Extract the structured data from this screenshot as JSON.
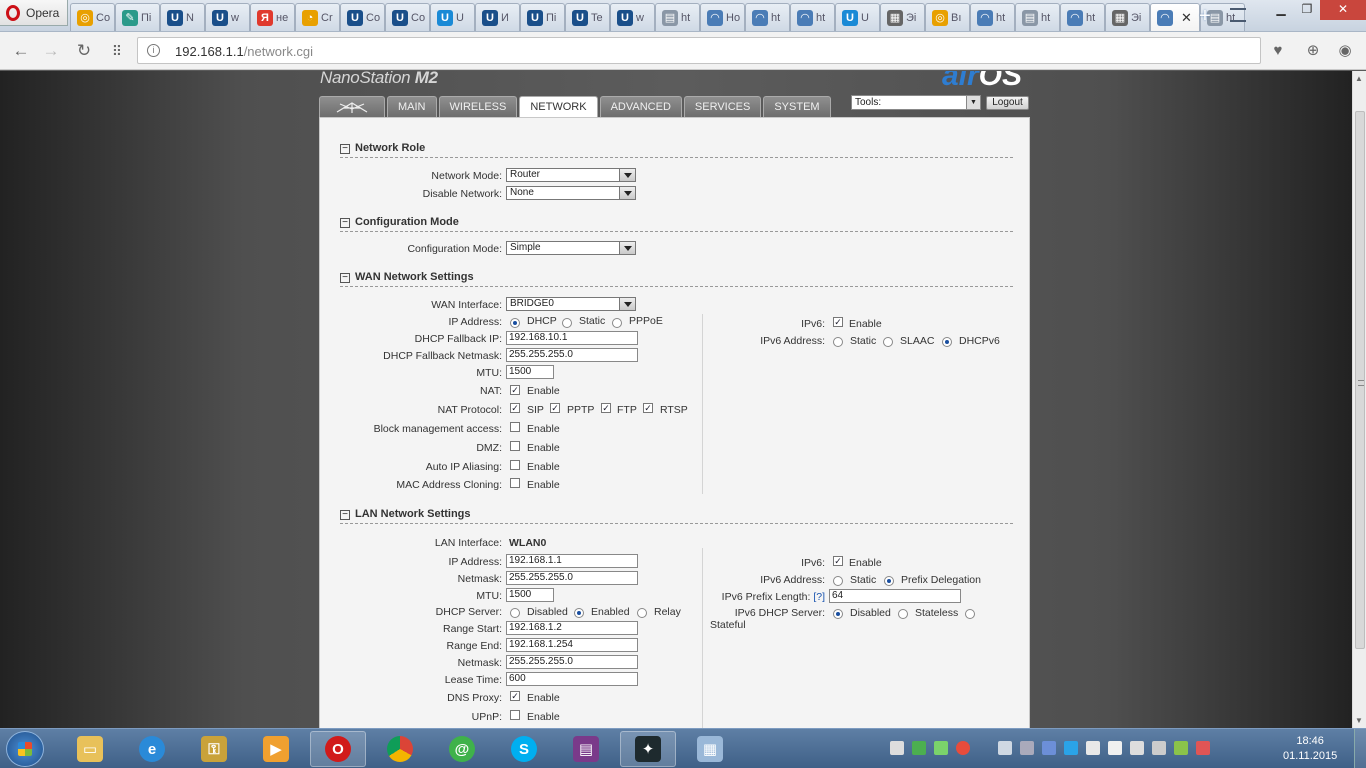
{
  "browser": {
    "name": "Opera",
    "tabs": [
      {
        "label": "Co",
        "icon": "opera-icon",
        "color": "#e8a000",
        "glyph": "◎"
      },
      {
        "label": "Пі",
        "icon": "pencil-icon",
        "color": "#2b9a8a",
        "glyph": "✎"
      },
      {
        "label": "N",
        "icon": "ubiquiti-icon",
        "color": "#1a4f8a",
        "glyph": "U"
      },
      {
        "label": "w",
        "icon": "ubiquiti-icon",
        "color": "#1a4f8a",
        "glyph": "U"
      },
      {
        "label": "не",
        "icon": "yandex-icon",
        "color": "#e03a2e",
        "glyph": "Я"
      },
      {
        "label": "Cr",
        "icon": "swirl-icon",
        "color": "#e8a000",
        "glyph": "◔"
      },
      {
        "label": "Co",
        "icon": "ubiquiti-icon",
        "color": "#1a4f8a",
        "glyph": "U"
      },
      {
        "label": "Co",
        "icon": "ubiquiti-icon",
        "color": "#1a4f8a",
        "glyph": "U"
      },
      {
        "label": "U",
        "icon": "ubiquiti-icon",
        "color": "#1a8ad6",
        "glyph": "U"
      },
      {
        "label": "И",
        "icon": "ubiquiti-icon",
        "color": "#1a4f8a",
        "glyph": "U"
      },
      {
        "label": "Пі",
        "icon": "ubiquiti-icon",
        "color": "#1a4f8a",
        "glyph": "U"
      },
      {
        "label": "Te",
        "icon": "ubiquiti-icon",
        "color": "#1a4f8a",
        "glyph": "U"
      },
      {
        "label": "w",
        "icon": "ubiquiti-icon",
        "color": "#1a4f8a",
        "glyph": "U"
      },
      {
        "label": "ht",
        "icon": "page-icon",
        "color": "#8a97a6",
        "glyph": "▤"
      },
      {
        "label": "Ho",
        "icon": "rss-icon",
        "color": "#4a7cb6",
        "glyph": "◠"
      },
      {
        "label": "ht",
        "icon": "rss-icon",
        "color": "#4a7cb6",
        "glyph": "◠"
      },
      {
        "label": "ht",
        "icon": "rss-icon",
        "color": "#4a7cb6",
        "glyph": "◠"
      },
      {
        "label": "U",
        "icon": "ubiquiti-icon",
        "color": "#1a8ad6",
        "glyph": "U"
      },
      {
        "label": "Эі",
        "icon": "grid-icon",
        "color": "#666666",
        "glyph": "▦"
      },
      {
        "label": "Bı",
        "icon": "opera-icon",
        "color": "#e8a000",
        "glyph": "◎"
      },
      {
        "label": "ht",
        "icon": "rss-icon",
        "color": "#4a7cb6",
        "glyph": "◠"
      },
      {
        "label": "ht",
        "icon": "page-icon",
        "color": "#8a97a6",
        "glyph": "▤"
      },
      {
        "label": "ht",
        "icon": "rss-icon",
        "color": "#4a7cb6",
        "glyph": "◠"
      },
      {
        "label": "Эі",
        "icon": "grid-icon",
        "color": "#666666",
        "glyph": "▦"
      },
      {
        "label": "",
        "icon": "rss-icon",
        "color": "#4a7cb6",
        "glyph": "◠",
        "active": true
      },
      {
        "label": "ht",
        "icon": "page-icon",
        "color": "#8a97a6",
        "glyph": "▤"
      }
    ],
    "url_host": "192.168.1.1",
    "url_path": "/network.cgi"
  },
  "header": {
    "brand_prefix": "NanoStation ",
    "brand_model": "M2",
    "logo_air": "air",
    "logo_os": "OS"
  },
  "nav": {
    "tabs": [
      "MAIN",
      "WIRELESS",
      "NETWORK",
      "ADVANCED",
      "SERVICES",
      "SYSTEM"
    ],
    "active": "NETWORK",
    "tools_label": "Tools:",
    "logout_label": "Logout"
  },
  "network_role": {
    "title": "Network Role",
    "network_mode_label": "Network Mode:",
    "network_mode_value": "Router",
    "disable_network_label": "Disable Network:",
    "disable_network_value": "None"
  },
  "configuration_mode": {
    "title": "Configuration Mode",
    "label": "Configuration Mode:",
    "value": "Simple"
  },
  "wan": {
    "title": "WAN Network Settings",
    "wan_interface_label": "WAN Interface:",
    "wan_interface_value": "BRIDGE0",
    "ip_address_label": "IP Address:",
    "ip_options": [
      "DHCP",
      "Static",
      "PPPoE"
    ],
    "ip_selected": "DHCP",
    "dhcp_fallback_ip_label": "DHCP Fallback IP:",
    "dhcp_fallback_ip_value": "192.168.10.1",
    "dhcp_fallback_netmask_label": "DHCP Fallback Netmask:",
    "dhcp_fallback_netmask_value": "255.255.255.0",
    "mtu_label": "MTU:",
    "mtu_value": "1500",
    "nat_label": "NAT:",
    "enable_text": "Enable",
    "nat_protocol_label": "NAT Protocol:",
    "nat_protocols": [
      "SIP",
      "PPTP",
      "FTP",
      "RTSP"
    ],
    "block_mgmt_label": "Block management access:",
    "dmz_label": "DMZ:",
    "auto_ip_label": "Auto IP Aliasing:",
    "mac_clone_label": "MAC Address Cloning:",
    "ipv6_label": "IPv6:",
    "ipv6_address_label": "IPv6 Address:",
    "ipv6_options": [
      "Static",
      "SLAAC",
      "DHCPv6"
    ],
    "ipv6_selected": "DHCPv6"
  },
  "lan": {
    "title": "LAN Network Settings",
    "lan_interface_label": "LAN Interface:",
    "lan_interface_value": "WLAN0",
    "ip_address_label": "IP Address:",
    "ip_address_value": "192.168.1.1",
    "netmask_label": "Netmask:",
    "netmask_value": "255.255.255.0",
    "mtu_label": "MTU:",
    "mtu_value": "1500",
    "dhcp_server_label": "DHCP Server:",
    "dhcp_options": [
      "Disabled",
      "Enabled",
      "Relay"
    ],
    "dhcp_selected": "Enabled",
    "range_start_label": "Range Start:",
    "range_start_value": "192.168.1.2",
    "range_end_label": "Range End:",
    "range_end_value": "192.168.1.254",
    "dhcp_netmask_label": "Netmask:",
    "dhcp_netmask_value": "255.255.255.0",
    "lease_time_label": "Lease Time:",
    "lease_time_value": "600",
    "dns_proxy_label": "DNS Proxy:",
    "upnp_label": "UPnP:",
    "enable_text": "Enable",
    "ipv6_label": "IPv6:",
    "ipv6_address_label": "IPv6 Address:",
    "ipv6_options": [
      "Static",
      "Prefix Delegation"
    ],
    "ipv6_selected": "Prefix Delegation",
    "ipv6_prefix_label": "IPv6 Prefix Length:",
    "ipv6_prefix_help": "[?]",
    "ipv6_prefix_value": "64",
    "ipv6_dhcp_label": "IPv6 DHCP Server:",
    "ipv6_dhcp_options": [
      "Disabled",
      "Stateless",
      "Stateful"
    ],
    "ipv6_dhcp_selected": "Disabled"
  },
  "taskbar": {
    "time": "18:46",
    "date": "01.11.2015"
  }
}
